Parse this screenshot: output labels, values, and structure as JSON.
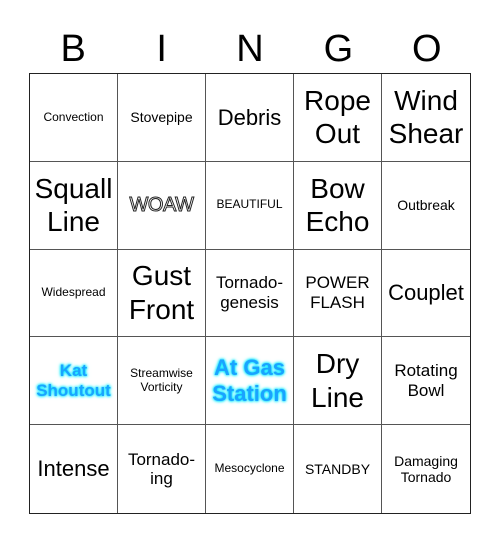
{
  "header": [
    "B",
    "I",
    "N",
    "G",
    "O"
  ],
  "cells": [
    {
      "text": "Convection",
      "size": "xs"
    },
    {
      "text": "Stovepipe",
      "size": "sm"
    },
    {
      "text": "Debris",
      "size": "lg"
    },
    {
      "text": "Rope Out",
      "size": "xl"
    },
    {
      "text": "Wind Shear",
      "size": "xl"
    },
    {
      "text": "Squall Line",
      "size": "xl"
    },
    {
      "text": "WOAW",
      "size": "outline"
    },
    {
      "text": "BEAUTIFUL",
      "size": "xs"
    },
    {
      "text": "Bow Echo",
      "size": "xl"
    },
    {
      "text": "Outbreak",
      "size": "sm"
    },
    {
      "text": "Widespread",
      "size": "xs"
    },
    {
      "text": "Gust Front",
      "size": "xl"
    },
    {
      "text": "Tornado-genesis",
      "size": "md"
    },
    {
      "text": "POWER FLASH",
      "size": "md"
    },
    {
      "text": "Couplet",
      "size": "lg"
    },
    {
      "text": "Kat Shoutout",
      "size": "md",
      "style": "glow"
    },
    {
      "text": "Streamwise Vorticity",
      "size": "xs"
    },
    {
      "text": "At Gas Station",
      "size": "lg",
      "style": "glow"
    },
    {
      "text": "Dry Line",
      "size": "xl"
    },
    {
      "text": "Rotating Bowl",
      "size": "md"
    },
    {
      "text": "Intense",
      "size": "lg"
    },
    {
      "text": "Tornado-ing",
      "size": "md"
    },
    {
      "text": "Mesocyclone",
      "size": "xs"
    },
    {
      "text": "STANDBY",
      "size": "sm"
    },
    {
      "text": "Damaging Tornado",
      "size": "sm"
    }
  ],
  "colors": {
    "glow_text": "#1aa3ff",
    "glow_halo": "#00e5ff",
    "grid_line": "#555555"
  }
}
